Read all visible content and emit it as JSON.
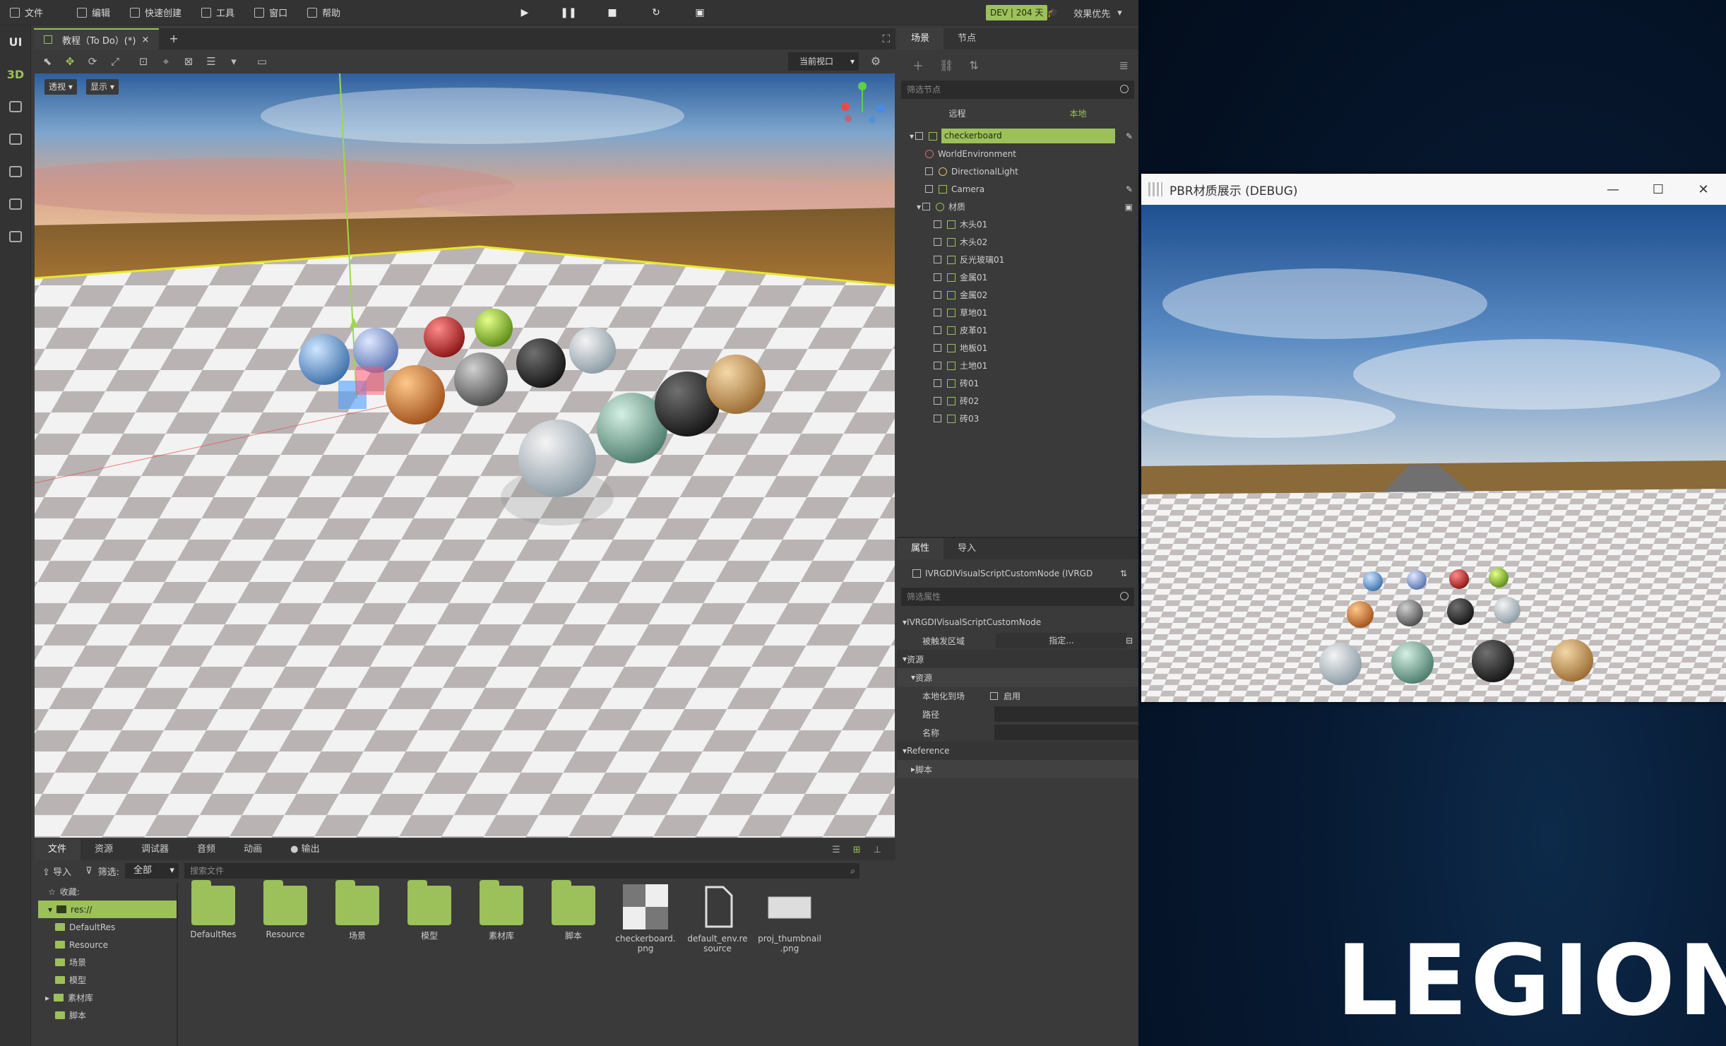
{
  "menu": {
    "items": [
      "文件",
      "编辑",
      "快速创建",
      "工具",
      "窗口",
      "帮助"
    ],
    "dev_badge": "DEV | 204 天",
    "quality": "效果优先"
  },
  "leftbar": {
    "ui": "UI",
    "td": "3D"
  },
  "viewport": {
    "tab_title": "教程（To Do）(*)",
    "add": "+",
    "persp": "透视",
    "display": "显示",
    "current_view": "当前视口"
  },
  "bottom": {
    "tabs": [
      "文件",
      "资源",
      "调试器",
      "音频",
      "动画",
      "输出"
    ],
    "import": "导入",
    "filter_label": "筛选:",
    "filter_value": "全部",
    "search_placeholder": "搜索文件",
    "tree": [
      "收藏:",
      "res://",
      "DefaultRes",
      "Resource",
      "场景",
      "模型",
      "素材库",
      "脚本"
    ],
    "files": [
      {
        "name": "DefaultRes"
      },
      {
        "name": "Resource"
      },
      {
        "name": "场景"
      },
      {
        "name": "模型"
      },
      {
        "name": "素材库"
      },
      {
        "name": "脚本"
      },
      {
        "name": "checkerboard.\npng"
      },
      {
        "name": "default_env.re\nsource"
      },
      {
        "name": "proj_thumbnail\n.png"
      }
    ]
  },
  "scene": {
    "tabs": [
      "场景",
      "节点"
    ],
    "filter_placeholder": "筛选节点",
    "remote": "远程",
    "local": "本地",
    "nodes": [
      "checkerboard",
      "WorldEnvironment",
      "DirectionalLight",
      "Camera",
      "材质",
      "木头01",
      "木头02",
      "反光玻璃01",
      "金属01",
      "金属02",
      "草地01",
      "皮革01",
      "地板01",
      "土地01",
      "砖01",
      "砖02",
      "砖03"
    ]
  },
  "props": {
    "tabs": [
      "属性",
      "导入"
    ],
    "object": "IVRGDIVisualScriptCustomNode (IVRGD",
    "filter_placeholder": "筛选属性",
    "class_name": "IVRGDIVisualScriptCustomNode",
    "trigger": "被触发区域",
    "assign": "指定...",
    "res_section": "资源",
    "res_sub": "资源",
    "local_scene": "本地化到场",
    "enable": "启用",
    "path": "路径",
    "name": "名称",
    "reference": "Reference",
    "script": "脚本"
  },
  "debug_window": {
    "title": "PBR材质展示 (DEBUG)",
    "minimize": "—",
    "maximize": "☐",
    "close": "✕"
  },
  "brand": {
    "logo": "LEGION"
  },
  "colors": {
    "accent": "#9cc05a",
    "sky_top": "#2e5f9e"
  }
}
